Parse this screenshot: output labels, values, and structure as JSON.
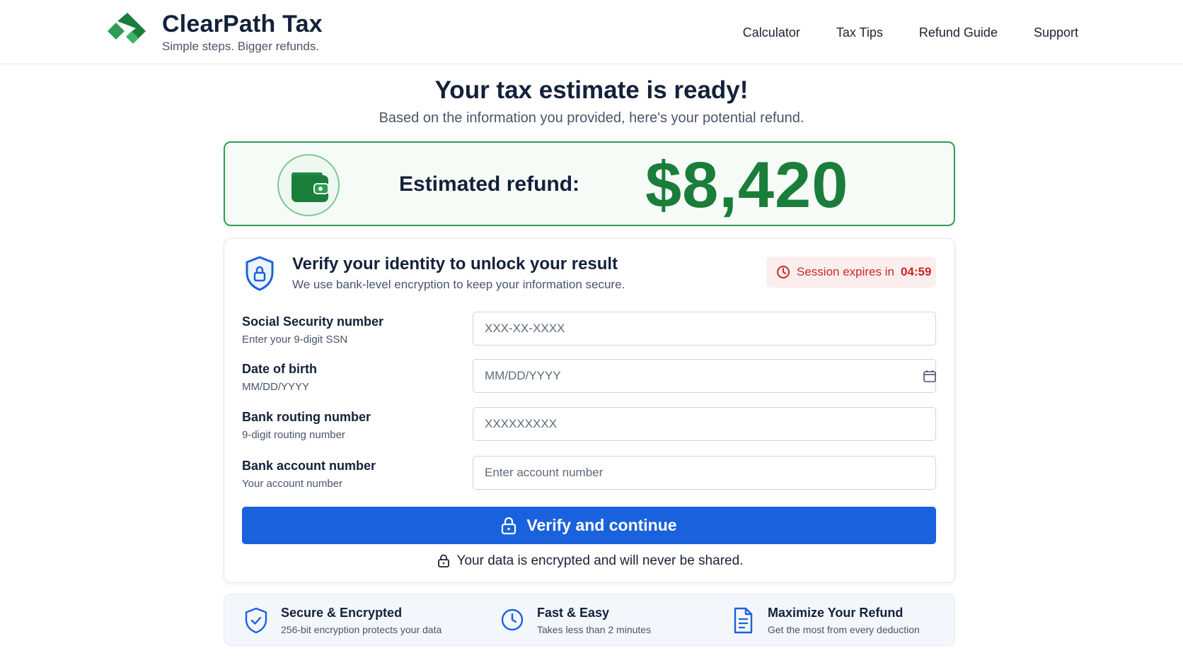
{
  "brand": {
    "name": "ClearPath Tax",
    "tagline": "Simple steps. Bigger refunds."
  },
  "nav": {
    "items": [
      "Calculator",
      "Tax Tips",
      "Refund Guide",
      "Support"
    ]
  },
  "hero": {
    "title": "Your tax estimate is ready!",
    "subtitle": "Based on the information you provided, here's your potential refund."
  },
  "refund": {
    "label": "Estimated refund:",
    "amount": "$8,420"
  },
  "verify": {
    "title": "Verify your identity to unlock your result",
    "subtitle": "We use bank-level encryption to keep your information secure.",
    "session_prefix": "Session expires in",
    "session_time": "04:59",
    "fields": [
      {
        "label": "Social Security number",
        "hint": "Enter your 9-digit SSN",
        "placeholder": "XXX-XX-XXXX"
      },
      {
        "label": "Date of birth",
        "hint": "MM/DD/YYYY",
        "placeholder": "MM/DD/YYYY"
      },
      {
        "label": "Bank routing number",
        "hint": "9-digit routing number",
        "placeholder": "XXXXXXXXX"
      },
      {
        "label": "Bank account number",
        "hint": "Your account number",
        "placeholder": "Enter account number"
      }
    ],
    "button_label": "Verify and continue",
    "privacy_note": "Your data is encrypted and will never be shared."
  },
  "features": [
    {
      "title": "Secure & Encrypted",
      "desc": "256-bit encryption protects your data",
      "icon": "shield-check-icon"
    },
    {
      "title": "Fast & Easy",
      "desc": "Takes less than 2 minutes",
      "icon": "clock-icon"
    },
    {
      "title": "Maximize Your Refund",
      "desc": "Get the most from every deduction",
      "icon": "document-icon"
    }
  ],
  "colors": {
    "brand_green": "#1b7d3a",
    "primary_blue": "#1a62dd",
    "alert_red": "#c62828"
  }
}
